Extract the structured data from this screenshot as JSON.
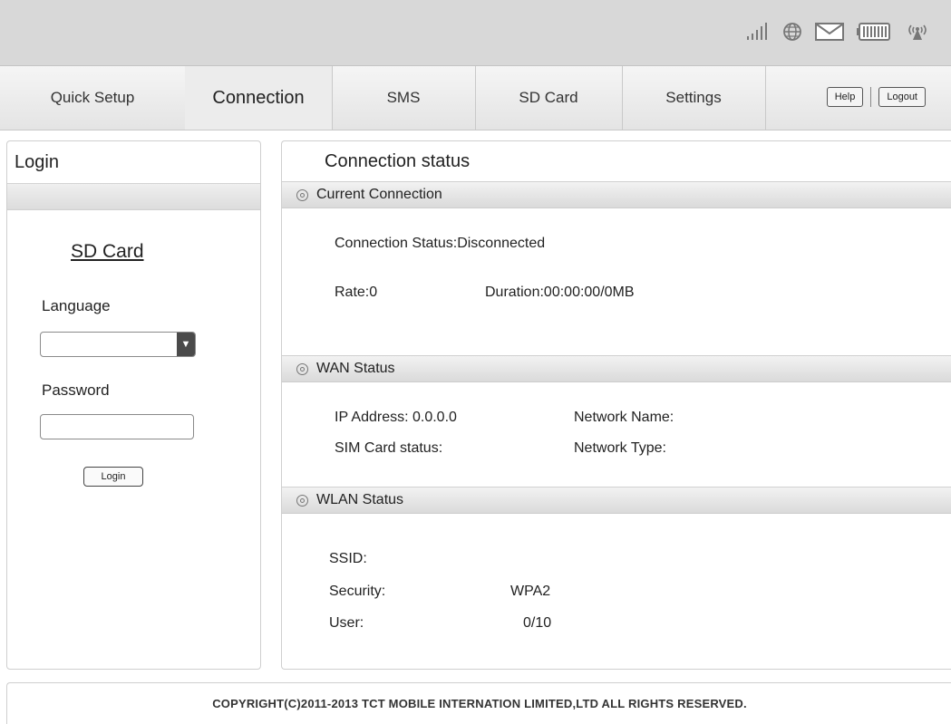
{
  "header": {
    "status_icons": [
      "signal-icon",
      "globe-icon",
      "mail-icon",
      "battery-icon",
      "wifi-icon"
    ]
  },
  "nav": {
    "items": [
      {
        "label": "Quick Setup",
        "active": false
      },
      {
        "label": "Connection",
        "active": true
      },
      {
        "label": "SMS",
        "active": false
      },
      {
        "label": "SD Card",
        "active": false
      },
      {
        "label": "Settings",
        "active": false
      }
    ],
    "help_label": "Help",
    "logout_label": "Logout"
  },
  "login_panel": {
    "title": "Login",
    "sd_card_link": "SD Card",
    "language_label": "Language",
    "language_value": "",
    "password_label": "Password",
    "password_value": "",
    "login_button": "Login"
  },
  "status_panel": {
    "title": "Connection status",
    "current_connection": {
      "heading": "Current Connection",
      "connection_status": "Connection Status:Disconnected",
      "rate": "Rate:0",
      "duration": "Duration:00:00:00/0MB"
    },
    "wan_status": {
      "heading": "WAN Status",
      "ip_address": "IP Address: 0.0.0.0",
      "network_name": "Network Name:",
      "sim_status": "SIM Card status:",
      "network_type": "Network Type:"
    },
    "wlan_status": {
      "heading": "WLAN Status",
      "ssid_label": "SSID:",
      "security_label": "Security:",
      "security_value": "WPA2",
      "user_label": "User:",
      "user_value": "0/10"
    }
  },
  "footer": {
    "copyright": "COPYRIGHT(C)2011-2013 TCT MOBILE INTERNATION LIMITED,LTD ALL RIGHTS RESERVED."
  }
}
